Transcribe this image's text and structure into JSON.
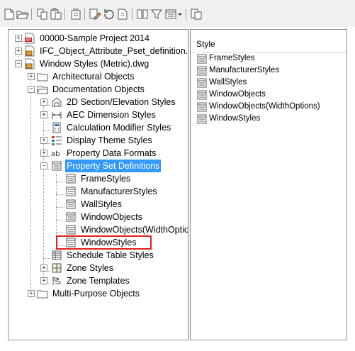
{
  "colors": {
    "selection": "#3399ff",
    "highlight": "#e02020",
    "folder": "#f5d77a"
  },
  "toolbar": {
    "buttons": [
      {
        "name": "new-icon"
      },
      {
        "name": "open-icon"
      },
      {
        "name": "copy-icon"
      },
      {
        "name": "paste-icon"
      },
      {
        "name": "purge-icon"
      },
      {
        "name": "edit-icon"
      },
      {
        "name": "repath-icon"
      },
      {
        "name": "help-doc-icon"
      },
      {
        "name": "synchronize-icon"
      },
      {
        "name": "filter-icon"
      },
      {
        "name": "view-toggle-icon"
      },
      {
        "name": "dropdown-arrow-icon"
      },
      {
        "name": "clipboard-icon"
      }
    ]
  },
  "tree": {
    "nodes": [
      {
        "label": "00000-Sample Project 2014"
      },
      {
        "label": "IFC_Object_Attribute_Pset_definition.dwg"
      },
      {
        "label": "Window Styles (Metric).dwg"
      },
      {
        "label": "Architectural Objects"
      },
      {
        "label": "Documentation Objects"
      },
      {
        "label": "2D Section/Elevation Styles"
      },
      {
        "label": "AEC Dimension Styles"
      },
      {
        "label": "Calculation Modifier Styles"
      },
      {
        "label": "Display Theme Styles"
      },
      {
        "label": "Property Data Formats"
      },
      {
        "label": "Property Set Definitions"
      },
      {
        "label": "FrameStyles"
      },
      {
        "label": "ManufacturerStyles"
      },
      {
        "label": "WallStyles"
      },
      {
        "label": "WindowObjects"
      },
      {
        "label": "WindowObjects(WidthOptions)"
      },
      {
        "label": "WindowStyles"
      },
      {
        "label": "Schedule Table Styles"
      },
      {
        "label": "Zone Styles"
      },
      {
        "label": "Zone Templates"
      },
      {
        "label": "Multi-Purpose Objects"
      }
    ]
  },
  "list": {
    "column_header": "Style",
    "rows": [
      "FrameStyles",
      "ManufacturerStyles",
      "WallStyles",
      "WindowObjects",
      "WindowObjects(WidthOptions)",
      "WindowStyles"
    ]
  }
}
